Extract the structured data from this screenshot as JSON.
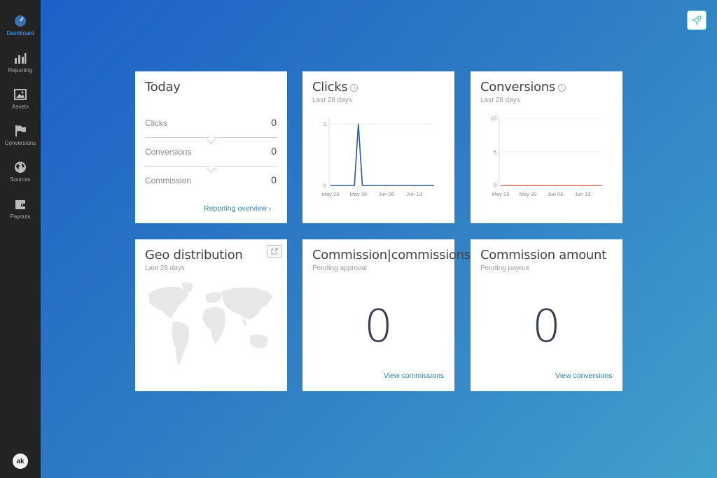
{
  "sidebar": {
    "items": [
      {
        "label": "Dashboard",
        "icon": "gauge-icon",
        "active": true
      },
      {
        "label": "Reporting",
        "icon": "bar-chart-icon"
      },
      {
        "label": "Assets",
        "icon": "image-icon"
      },
      {
        "label": "Conversions",
        "icon": "flag-icon"
      },
      {
        "label": "Sources",
        "icon": "globe-icon"
      },
      {
        "label": "Payouts",
        "icon": "wallet-icon"
      }
    ],
    "avatar": "ak"
  },
  "today": {
    "title": "Today",
    "rows": [
      {
        "label": "Clicks",
        "value": "0"
      },
      {
        "label": "Conversions",
        "value": "0"
      },
      {
        "label": "Commission",
        "value": "0"
      }
    ],
    "link": "Reporting overview ›"
  },
  "clicks_card": {
    "title": "Clicks",
    "subtitle": "Last 28 days",
    "info": "i"
  },
  "conversions_card": {
    "title": "Conversions",
    "subtitle": "Last 28 days",
    "info": "i"
  },
  "geo": {
    "title": "Geo distribution",
    "subtitle": "Last 28 days"
  },
  "commission_count": {
    "title": "Commission|commissions",
    "subtitle": "Pending approval",
    "value": "0",
    "link": "View commissions"
  },
  "commission_amount": {
    "title": "Commission amount",
    "subtitle": "Pending payout",
    "value": "0",
    "link": "View conversions"
  },
  "chart_data": [
    {
      "type": "line",
      "x": [
        "May 23",
        "May 24",
        "May 25",
        "May 26",
        "May 27",
        "May 28",
        "May 29",
        "May 30",
        "May 31",
        "Jun 01",
        "Jun 02",
        "Jun 03",
        "Jun 04",
        "Jun 05",
        "Jun 06",
        "Jun 07",
        "Jun 08",
        "Jun 09",
        "Jun 10",
        "Jun 11",
        "Jun 12",
        "Jun 13",
        "Jun 14",
        "Jun 15",
        "Jun 16",
        "Jun 17",
        "Jun 18"
      ],
      "series": [
        {
          "values": [
            0,
            0,
            0,
            0,
            0,
            0,
            0,
            1,
            0,
            0,
            0,
            0,
            0,
            0,
            0,
            0,
            0,
            0,
            0,
            0,
            0,
            0,
            0,
            0,
            0,
            0,
            0
          ],
          "color": "#2a5a9a"
        }
      ],
      "xticks": [
        "May 23",
        "May 30",
        "Jun 06",
        "Jun 13"
      ],
      "yticks": [
        "0",
        "1"
      ],
      "ylim": [
        0,
        1.1
      ],
      "grid": true
    },
    {
      "type": "line",
      "x": [
        "May 23",
        "May 24",
        "May 25",
        "May 26",
        "May 27",
        "May 28",
        "May 29",
        "May 30",
        "May 31",
        "Jun 01",
        "Jun 02",
        "Jun 03",
        "Jun 04",
        "Jun 05",
        "Jun 06",
        "Jun 07",
        "Jun 08",
        "Jun 09",
        "Jun 10",
        "Jun 11",
        "Jun 12",
        "Jun 13",
        "Jun 14",
        "Jun 15",
        "Jun 16",
        "Jun 17",
        "Jun 18"
      ],
      "series": [
        {
          "values": [
            0,
            0,
            0,
            0,
            0,
            0,
            0,
            0,
            0,
            0,
            0,
            0,
            0,
            0,
            0,
            0,
            0,
            0,
            0,
            0,
            0,
            0,
            0,
            0,
            0,
            0,
            0
          ],
          "color": "#e06a4a"
        }
      ],
      "xticks": [
        "May 23",
        "May 30",
        "Jun 06",
        "Jun 13"
      ],
      "yticks": [
        "0",
        "5",
        "10"
      ],
      "ylim": [
        0,
        10
      ],
      "grid": true
    }
  ]
}
